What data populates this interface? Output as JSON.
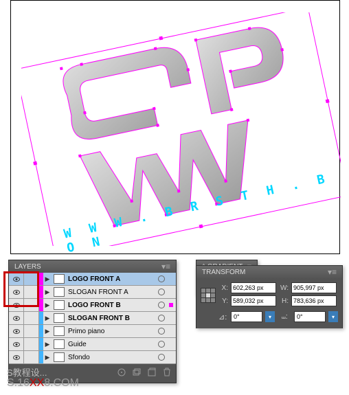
{
  "canvas": {
    "url_text": "W W W . B R S T H . B O N"
  },
  "layers": {
    "title": "LAYERS",
    "rows": [
      {
        "name": "LOGO FRONT A",
        "bold": true,
        "color": "#ff00ff",
        "selected": true,
        "visible": true,
        "hasDot": false
      },
      {
        "name": "SLOGAN FRONT A",
        "bold": false,
        "color": "#ff00ff",
        "selected": false,
        "visible": true,
        "hasDot": false
      },
      {
        "name": "LOGO FRONT B",
        "bold": true,
        "color": "#ff00ff",
        "selected": false,
        "visible": true,
        "hasDot": true
      },
      {
        "name": "SLOGAN FRONT B",
        "bold": true,
        "color": "#43b5ff",
        "selected": false,
        "visible": true,
        "hasDot": false
      },
      {
        "name": "Primo piano",
        "bold": false,
        "color": "#43b5ff",
        "selected": false,
        "visible": true,
        "hasDot": false
      },
      {
        "name": "Guide",
        "bold": false,
        "color": "#43b5ff",
        "selected": false,
        "visible": true,
        "hasDot": false
      },
      {
        "name": "Sfondo",
        "bold": false,
        "color": "#43b5ff",
        "selected": false,
        "visible": true,
        "hasDot": false
      }
    ]
  },
  "gradient": {
    "title": "GRADIENT"
  },
  "transform": {
    "title": "TRANSFORM",
    "x_label": "X:",
    "y_label": "Y:",
    "w_label": "W:",
    "h_label": "H:",
    "x_val": "602,263 px",
    "y_val": "589,032 px",
    "w_val": "905,997 px",
    "h_val": "783,636 px",
    "angle1": "0°",
    "angle2": "0°"
  },
  "watermark": {
    "txt": "S教程设...",
    "url_pre": "S.16",
    "url_xx": "XX",
    "url_post": "8.COM"
  }
}
